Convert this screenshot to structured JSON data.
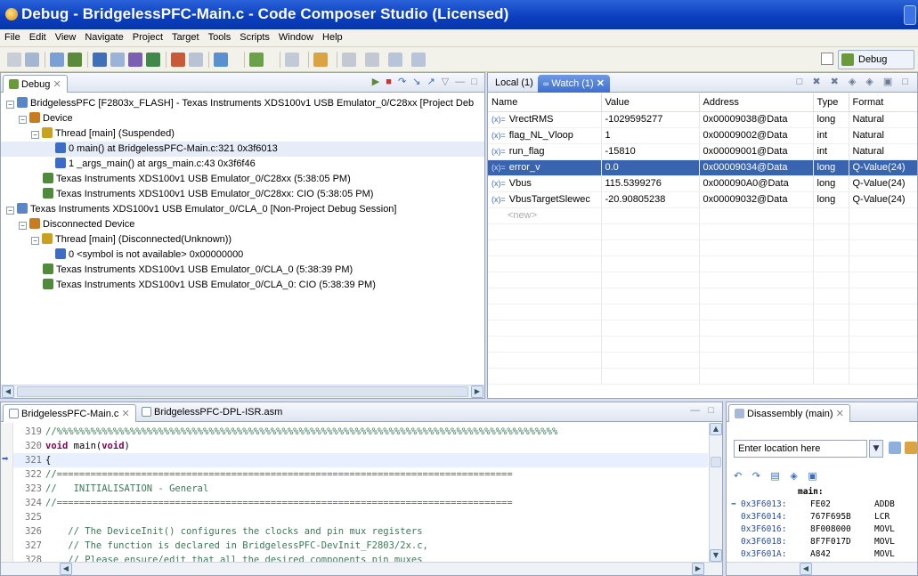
{
  "window": {
    "title": "Debug - BridgelessPFC-Main.c - Code Composer Studio (Licensed)"
  },
  "menu": [
    "File",
    "Edit",
    "View",
    "Navigate",
    "Project",
    "Target",
    "Tools",
    "Scripts",
    "Window",
    "Help"
  ],
  "perspective": {
    "label": "Debug"
  },
  "debug_view": {
    "tab_label": "Debug",
    "tree": [
      {
        "indent": 0,
        "expander": "−",
        "icon": "debug-session-icon",
        "text": "BridgelessPFC [F2803x_FLASH] - Texas Instruments XDS100v1 USB Emulator_0/C28xx [Project Deb"
      },
      {
        "indent": 1,
        "expander": "−",
        "icon": "device-icon",
        "text": "Device"
      },
      {
        "indent": 2,
        "expander": "−",
        "icon": "thread-icon",
        "text": "Thread [main] (Suspended)"
      },
      {
        "indent": 3,
        "expander": "",
        "icon": "stack-frame-icon",
        "text": "0 main() at BridgelessPFC-Main.c:321 0x3f6013",
        "selected": true
      },
      {
        "indent": 3,
        "expander": "",
        "icon": "stack-frame-icon",
        "text": "1 _args_main() at args_main.c:43 0x3f6f46"
      },
      {
        "indent": 2,
        "expander": "",
        "icon": "emulator-icon",
        "text": "Texas Instruments XDS100v1 USB Emulator_0/C28xx (5:38:05 PM)"
      },
      {
        "indent": 2,
        "expander": "",
        "icon": "emulator-icon",
        "text": "Texas Instruments XDS100v1 USB Emulator_0/C28xx: CIO (5:38:05 PM)"
      },
      {
        "indent": 0,
        "expander": "−",
        "icon": "debug-session-icon",
        "text": "Texas Instruments XDS100v1 USB Emulator_0/CLA_0 [Non-Project Debug Session]"
      },
      {
        "indent": 1,
        "expander": "−",
        "icon": "device-icon",
        "text": "Disconnected Device"
      },
      {
        "indent": 2,
        "expander": "−",
        "icon": "thread-icon",
        "text": "Thread [main] (Disconnected(Unknown))"
      },
      {
        "indent": 3,
        "expander": "",
        "icon": "stack-frame-icon",
        "text": "0 <symbol is not available> 0x00000000"
      },
      {
        "indent": 2,
        "expander": "",
        "icon": "emulator-icon",
        "text": "Texas Instruments XDS100v1 USB Emulator_0/CLA_0 (5:38:39 PM)"
      },
      {
        "indent": 2,
        "expander": "",
        "icon": "emulator-icon",
        "text": "Texas Instruments XDS100v1 USB Emulator_0/CLA_0: CIO (5:38:39 PM)"
      }
    ]
  },
  "watch_view": {
    "tabs": [
      "Local (1)",
      "Watch (1)"
    ],
    "columns": [
      "Name",
      "Value",
      "Address",
      "Type",
      "Format"
    ],
    "rows": [
      {
        "name": "VrectRMS",
        "value": "-1029595277",
        "address": "0x00009038@Data",
        "type": "long",
        "format": "Natural"
      },
      {
        "name": "flag_NL_Vloop",
        "value": "1",
        "address": "0x00009002@Data",
        "type": "int",
        "format": "Natural"
      },
      {
        "name": "run_flag",
        "value": "-15810",
        "address": "0x00009001@Data",
        "type": "int",
        "format": "Natural"
      },
      {
        "name": "error_v",
        "value": "0.0",
        "address": "0x00009034@Data",
        "type": "long",
        "format": "Q-Value(24)",
        "selected": true
      },
      {
        "name": "Vbus",
        "value": "115.5399276",
        "address": "0x000090A0@Data",
        "type": "long",
        "format": "Q-Value(24)"
      },
      {
        "name": "VbusTargetSlewec",
        "value": "-20.90805238",
        "address": "0x00009032@Data",
        "type": "long",
        "format": "Q-Value(24)"
      }
    ],
    "new_placeholder": "<new>"
  },
  "editor": {
    "tabs": [
      "BridgelessPFC-Main.c",
      "BridgelessPFC-DPL-ISR.asm"
    ],
    "lines": [
      {
        "no": "319",
        "text": "//%%%%%%%%%%%%%%%%%%%%%%%%%%%%%%%%%%%%%%%%%%%%%%%%%%%%%%%%%%%%%%%%%%%%%%%%%%%%%%%%%%%%%%%%%",
        "kind": "comment"
      },
      {
        "no": "320",
        "text": "void main(void)",
        "kind": "decl"
      },
      {
        "no": "321",
        "text": "{",
        "kind": "current"
      },
      {
        "no": "322",
        "text": "//=================================================================================",
        "kind": "comment"
      },
      {
        "no": "323",
        "text": "//   INITIALISATION - General",
        "kind": "comment"
      },
      {
        "no": "324",
        "text": "//=================================================================================",
        "kind": "comment"
      },
      {
        "no": "325",
        "text": "",
        "kind": "plain"
      },
      {
        "no": "326",
        "text": "    // The DeviceInit() configures the clocks and pin mux registers",
        "kind": "comment"
      },
      {
        "no": "327",
        "text": "    // The function is declared in BridgelessPFC-DevInit_F2803/2x.c,",
        "kind": "comment"
      },
      {
        "no": "328",
        "text": "    // Please ensure/edit that all the desired components pin muxes",
        "kind": "comment"
      }
    ]
  },
  "disassembly": {
    "tab_label": "Disassembly (main)",
    "location_placeholder": "Enter location here",
    "label": "main:",
    "lines": [
      {
        "addr": "0x3F6013:",
        "op": "FE02",
        "mn": "ADDB",
        "current": true
      },
      {
        "addr": "0x3F6014:",
        "op": "767F695B",
        "mn": "LCR"
      },
      {
        "addr": "0x3F6016:",
        "op": "8F008000",
        "mn": "MOVL"
      },
      {
        "addr": "0x3F6018:",
        "op": "8F7F017D",
        "mn": "MOVL"
      },
      {
        "addr": "0x3F601A:",
        "op": "A842",
        "mn": "MOVL"
      }
    ]
  }
}
